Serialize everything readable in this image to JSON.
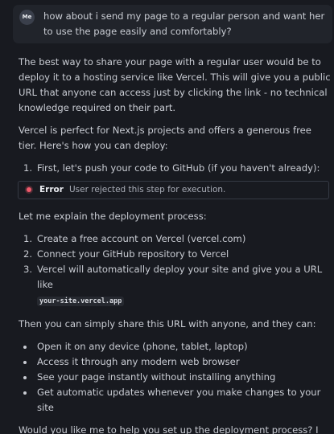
{
  "user_message": {
    "avatar_initials": "Me",
    "text": "how about i send my page to a regular person and want her to use the page easily and comfortably?"
  },
  "assistant": {
    "intro": "The best way to share your page with a regular user would be to deploy it to a hosting service like Vercel. This will give you a public URL that anyone can access just by clicking the link - no technical knowledge required on their part.",
    "vercel_note": "Vercel is perfect for Next.js projects and offers a generous free tier. Here's how you can deploy:",
    "step_one": {
      "number": "1.",
      "text": "First, let's push your code to GitHub (if you haven't already):"
    },
    "error": {
      "label": "Error",
      "message": "User rejected this step for execution."
    },
    "explain": "Let me explain the deployment process:",
    "process_steps": [
      {
        "number": "1.",
        "text": "Create a free account on Vercel (vercel.com)"
      },
      {
        "number": "2.",
        "text": "Connect your GitHub repository to Vercel"
      },
      {
        "number": "3.",
        "text": "Vercel will automatically deploy your site and give you a URL like"
      }
    ],
    "example_url": "your-site.vercel.app",
    "share_intro": "Then you can simply share this URL with anyone, and they can:",
    "benefits": [
      "Open it on any device (phone, tablet, laptop)",
      "Access it through any modern web browser",
      "See your page instantly without installing anything",
      "Get automatic updates whenever you make changes to your site"
    ],
    "closing": "Would you like me to help you set up the deployment process? I can guide you through each step."
  },
  "colors": {
    "background": "#181a20",
    "user_bubble": "#21242b",
    "text": "#c9ccd3",
    "error_dot": "#f05a6b"
  }
}
